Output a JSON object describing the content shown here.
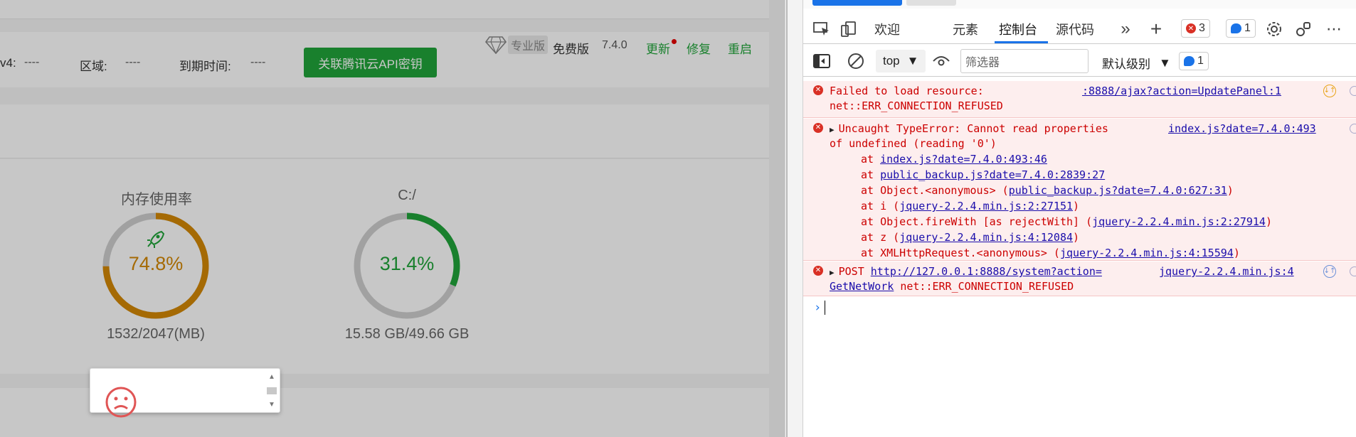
{
  "app": {
    "info": {
      "ipv4_label": "v4:",
      "ipv4_value": "----",
      "region_label": "区域:",
      "region_value": "----",
      "expiry_label": "到期时间:",
      "expiry_value": "----",
      "api_button": "关联腾讯云API密钥"
    },
    "header": {
      "pro_label": "专业版",
      "free_label": "免费版",
      "version": "7.4.0",
      "update": "更新",
      "repair": "修复",
      "restart": "重启"
    },
    "gauges": [
      {
        "title": "内存使用率",
        "value": "74.8%",
        "fraction": 0.748,
        "sub": "1532/2047(MB)",
        "color": "#d48806"
      },
      {
        "title": "C:/",
        "value": "31.4%",
        "fraction": 0.314,
        "sub": "15.58 GB/49.66 GB",
        "color": "#20a53a"
      }
    ],
    "colors": {
      "accent": "#20a53a",
      "warning": "#d48806"
    }
  },
  "devtools": {
    "tabs": [
      {
        "label": "欢迎"
      },
      {
        "label": "元素"
      },
      {
        "label": "控制台"
      },
      {
        "label": "源代码"
      }
    ],
    "icons": {
      "more_tabs": "»",
      "add_tab": "+",
      "settings": "settings-icon",
      "more": "⋯"
    },
    "error_count": "3",
    "info_count": "1",
    "filterbar": {
      "context": "top",
      "filter_placeholder": "筛选器",
      "level": "默认级别",
      "issue_count": "1"
    },
    "messages": [
      {
        "lines": [
          "Failed to load resource:",
          "net::ERR_CONNECTION_REFUSED"
        ],
        "source": ":8888/ajax?action=UpdatePanel:1"
      },
      {
        "lines": [
          "Uncaught TypeError: Cannot read properties",
          "of undefined (reading '0')"
        ],
        "source": "index.js?date=7.4.0:493",
        "stack": [
          {
            "prefix": "at ",
            "link": "index.js?date=7.4.0:493:46",
            "suffix": ""
          },
          {
            "prefix": "at ",
            "link": "public_backup.js?date=7.4.0:2839:27",
            "suffix": ""
          },
          {
            "prefix": "at Object.<anonymous> (",
            "link": "public_backup.js?date=7.4.0:627:31",
            "suffix": ")"
          },
          {
            "prefix": "at i (",
            "link": "jquery-2.2.4.min.js:2:27151",
            "suffix": ")"
          },
          {
            "prefix": "at Object.fireWith [as rejectWith] (",
            "link": "jquery-2.2.4.min.js:2:27914",
            "suffix": ")"
          },
          {
            "prefix": "at z (",
            "link": "jquery-2.2.4.min.js:4:12084",
            "suffix": ")"
          },
          {
            "prefix": "at XMLHttpRequest.<anonymous> (",
            "link": "jquery-2.2.4.min.js:4:15594",
            "suffix": ")"
          }
        ]
      },
      {
        "method": "POST",
        "url_line1": "http://127.0.0.1:8888/system?action=",
        "url_line2": "GetNetWork",
        "error": "net::ERR_CONNECTION_REFUSED",
        "source": "jquery-2.2.4.min.js:4"
      }
    ],
    "prompt": "›"
  }
}
